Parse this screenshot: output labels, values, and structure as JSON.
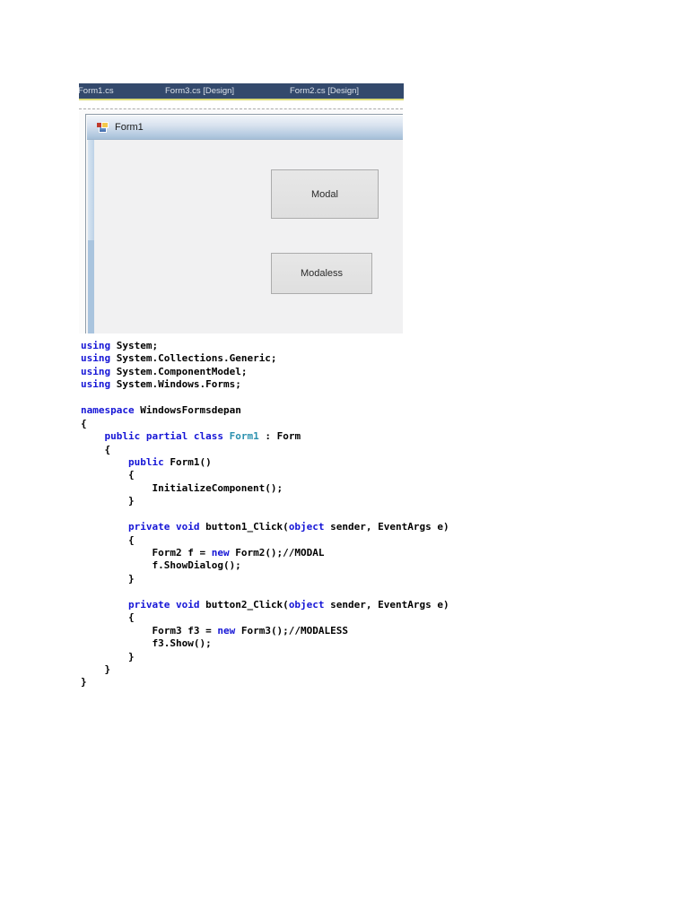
{
  "tabs": [
    {
      "label": "Form1.cs"
    },
    {
      "label": "Form3.cs [Design]"
    },
    {
      "label": "Form2.cs [Design]"
    }
  ],
  "designer": {
    "form_title": "Form1",
    "buttons": [
      {
        "label": "Modal"
      },
      {
        "label": "Modaless"
      }
    ]
  },
  "colors": {
    "tab_bar_bg": "#33496C",
    "tab_underline": "#DBDB76",
    "tab_text": "#DCE2EA",
    "title_bar_top": "#F0F4F9",
    "title_bar_bottom": "#A5BFD8",
    "form_body": "#F1F1F2",
    "scrollbar_track": "#A9C4DE",
    "scrollbar_thumb": "#D8E5F1",
    "button_bg": "#E7E7E7",
    "button_border": "#ACACAC",
    "keyword_color": "#1515D6",
    "type_color": "#2B91AF",
    "code_text": "#000000"
  },
  "code": {
    "lines": [
      [
        {
          "t": "using",
          "c": "kw"
        },
        {
          "t": " System;"
        }
      ],
      [
        {
          "t": "using",
          "c": "kw"
        },
        {
          "t": " System.Collections.Generic;"
        }
      ],
      [
        {
          "t": "using",
          "c": "kw"
        },
        {
          "t": " System.ComponentModel;"
        }
      ],
      [
        {
          "t": "using",
          "c": "kw"
        },
        {
          "t": " System.Windows.Forms;"
        }
      ],
      [],
      [
        {
          "t": "namespace",
          "c": "kw"
        },
        {
          "t": " WindowsFormsdepan"
        }
      ],
      [
        {
          "t": "{"
        }
      ],
      [
        {
          "t": "    "
        },
        {
          "t": "public partial class",
          "c": "kw"
        },
        {
          "t": " "
        },
        {
          "t": "Form1",
          "c": "ty"
        },
        {
          "t": " : Form"
        }
      ],
      [
        {
          "t": "    {"
        }
      ],
      [
        {
          "t": "        "
        },
        {
          "t": "public",
          "c": "kw"
        },
        {
          "t": " Form1()"
        }
      ],
      [
        {
          "t": "        {"
        }
      ],
      [
        {
          "t": "            InitializeComponent();"
        }
      ],
      [
        {
          "t": "        }"
        }
      ],
      [],
      [
        {
          "t": "        "
        },
        {
          "t": "private void",
          "c": "kw"
        },
        {
          "t": " button1_Click("
        },
        {
          "t": "object",
          "c": "kw"
        },
        {
          "t": " sender, EventArgs e)"
        }
      ],
      [
        {
          "t": "        {"
        }
      ],
      [
        {
          "t": "            Form2 f = "
        },
        {
          "t": "new",
          "c": "kw"
        },
        {
          "t": " Form2();//MODAL"
        }
      ],
      [
        {
          "t": "            f.ShowDialog();"
        }
      ],
      [
        {
          "t": "        }"
        }
      ],
      [],
      [
        {
          "t": "        "
        },
        {
          "t": "private void",
          "c": "kw"
        },
        {
          "t": " button2_Click("
        },
        {
          "t": "object",
          "c": "kw"
        },
        {
          "t": " sender, EventArgs e)"
        }
      ],
      [
        {
          "t": "        {"
        }
      ],
      [
        {
          "t": "            Form3 f3 = "
        },
        {
          "t": "new",
          "c": "kw"
        },
        {
          "t": " Form3();//MODALESS"
        }
      ],
      [
        {
          "t": "            f3.Show();"
        }
      ],
      [
        {
          "t": "        }"
        }
      ],
      [
        {
          "t": "    }"
        }
      ],
      [
        {
          "t": "}"
        }
      ]
    ]
  }
}
